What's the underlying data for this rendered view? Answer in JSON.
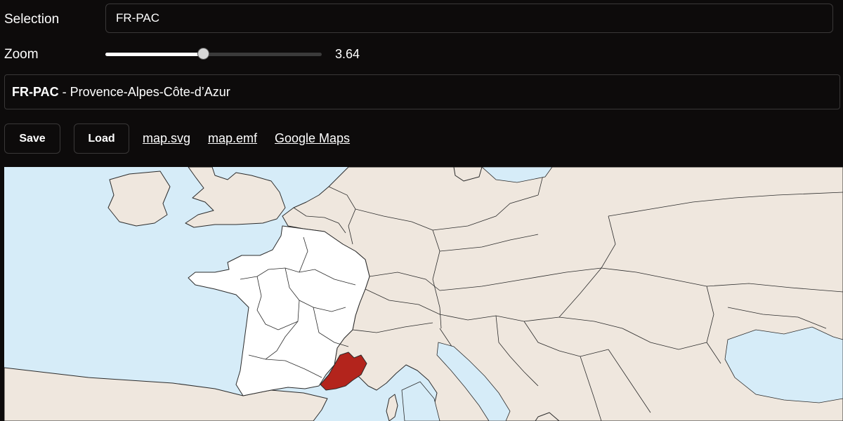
{
  "form": {
    "selection_label": "Selection",
    "selection_value": "FR-PAC",
    "zoom_label": "Zoom",
    "zoom_value": "3.64",
    "zoom_level_fraction": 0.455
  },
  "info": {
    "code": "FR-PAC",
    "separator": " - ",
    "name": "Provence-Alpes-Côte-d’Azur"
  },
  "toolbar": {
    "save_label": "Save",
    "load_label": "Load",
    "links": [
      "map.svg",
      "map.emf",
      "Google Maps"
    ]
  },
  "map": {
    "sea_color": "#d6ecf8",
    "land_color": "#efe7de",
    "france_color": "#ffffff",
    "highlight_color": "#b3241c",
    "border_color": "#2b2b2b"
  }
}
